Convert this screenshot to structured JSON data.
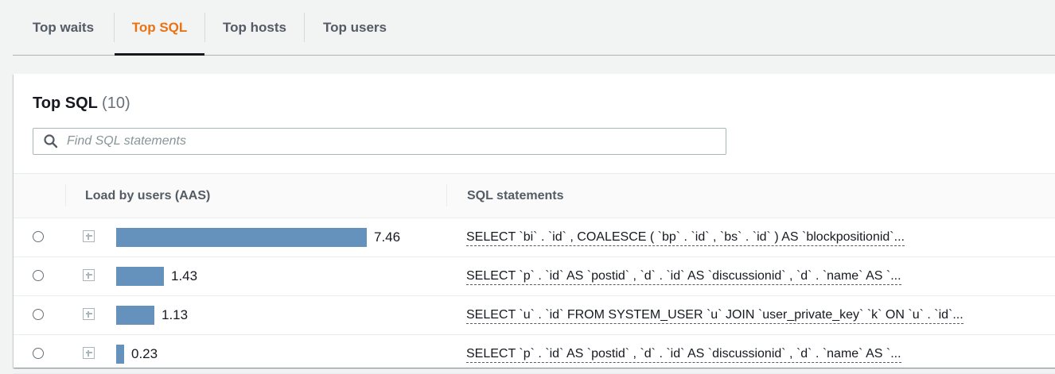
{
  "tabs": [
    {
      "label": "Top waits",
      "active": false
    },
    {
      "label": "Top SQL",
      "active": true
    },
    {
      "label": "Top hosts",
      "active": false
    },
    {
      "label": "Top users",
      "active": false
    }
  ],
  "colors": {
    "active_tab": "#ec7211",
    "bar": "#6592bd"
  },
  "panel": {
    "title": "Top SQL",
    "count": "(10)",
    "search_placeholder": "Find SQL statements",
    "search_icon": "search-icon"
  },
  "table": {
    "columns": [
      "Load by users (AAS)",
      "SQL statements"
    ],
    "rows": [
      {
        "load": 7.46,
        "load_label": "7.46",
        "sql": "SELECT `bi` . `id` , COALESCE ( `bp` . `id` , `bs` . `id` ) AS `blockpositionid`..."
      },
      {
        "load": 1.43,
        "load_label": "1.43",
        "sql": "SELECT `p` . `id` AS `postid` , `d` . `id` AS `discussionid` , `d` . `name` AS `..."
      },
      {
        "load": 1.13,
        "load_label": "1.13",
        "sql": "SELECT `u` . `id` FROM SYSTEM_USER `u` JOIN `user_private_key` `k` ON `u` . `id`..."
      },
      {
        "load": 0.23,
        "load_label": "0.23",
        "sql": "SELECT `p` . `id` AS `postid` , `d` . `id` AS `discussionid` , `d` . `name` AS `..."
      }
    ]
  }
}
